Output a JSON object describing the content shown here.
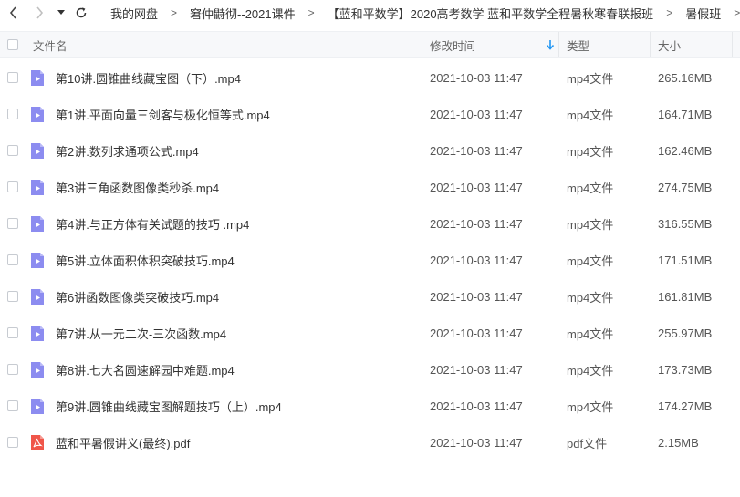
{
  "nav": {
    "back_icon": "chevron-left-icon",
    "forward_icon": "chevron-right-icon",
    "dropdown_icon": "caret-down-icon",
    "refresh_icon": "refresh-icon",
    "breadcrumbs": [
      "我的网盘",
      "窘仲鼭彻--2021课件",
      "【蓝和平数学】2020高考数学 蓝和平数学全程暑秋寒春联报班",
      "暑假班"
    ],
    "separator": ">"
  },
  "table": {
    "columns": {
      "name": "文件名",
      "modified": "修改时间",
      "type": "类型",
      "size": "大小"
    },
    "sort": {
      "column": "modified",
      "direction": "descending",
      "color": "#2196f3"
    },
    "rows": [
      {
        "name": "第10讲.圆锥曲线藏宝图（下）.mp4",
        "date": "2021-10-03 11:47",
        "type": "mp4文件",
        "size": "265.16MB",
        "icon": "video-file-icon"
      },
      {
        "name": "第1讲.平面向量三剑客与极化恒等式.mp4",
        "date": "2021-10-03 11:47",
        "type": "mp4文件",
        "size": "164.71MB",
        "icon": "video-file-icon"
      },
      {
        "name": "第2讲.数列求通项公式.mp4",
        "date": "2021-10-03 11:47",
        "type": "mp4文件",
        "size": "162.46MB",
        "icon": "video-file-icon"
      },
      {
        "name": "第3讲三角函数图像类秒杀.mp4",
        "date": "2021-10-03 11:47",
        "type": "mp4文件",
        "size": "274.75MB",
        "icon": "video-file-icon"
      },
      {
        "name": "第4讲.与正方体有关试题的技巧 .mp4",
        "date": "2021-10-03 11:47",
        "type": "mp4文件",
        "size": "316.55MB",
        "icon": "video-file-icon"
      },
      {
        "name": "第5讲.立体面积体积突破技巧.mp4",
        "date": "2021-10-03 11:47",
        "type": "mp4文件",
        "size": "171.51MB",
        "icon": "video-file-icon"
      },
      {
        "name": "第6讲函数图像类突破技巧.mp4",
        "date": "2021-10-03 11:47",
        "type": "mp4文件",
        "size": "161.81MB",
        "icon": "video-file-icon"
      },
      {
        "name": "第7讲.从一元二次-三次函数.mp4",
        "date": "2021-10-03 11:47",
        "type": "mp4文件",
        "size": "255.97MB",
        "icon": "video-file-icon"
      },
      {
        "name": "第8讲.七大名圆速解园中难题.mp4",
        "date": "2021-10-03 11:47",
        "type": "mp4文件",
        "size": "173.73MB",
        "icon": "video-file-icon"
      },
      {
        "name": "第9讲.圆锥曲线藏宝图解题技巧（上）.mp4",
        "date": "2021-10-03 11:47",
        "type": "mp4文件",
        "size": "174.27MB",
        "icon": "video-file-icon"
      },
      {
        "name": "蓝和平暑假讲义(最终).pdf",
        "date": "2021-10-03 11:47",
        "type": "pdf文件",
        "size": "2.15MB",
        "icon": "pdf-file-icon"
      }
    ]
  },
  "colors": {
    "video_icon": "#8c8cf0",
    "pdf_icon": "#f0564a",
    "header_bg": "#f7f8fa"
  }
}
